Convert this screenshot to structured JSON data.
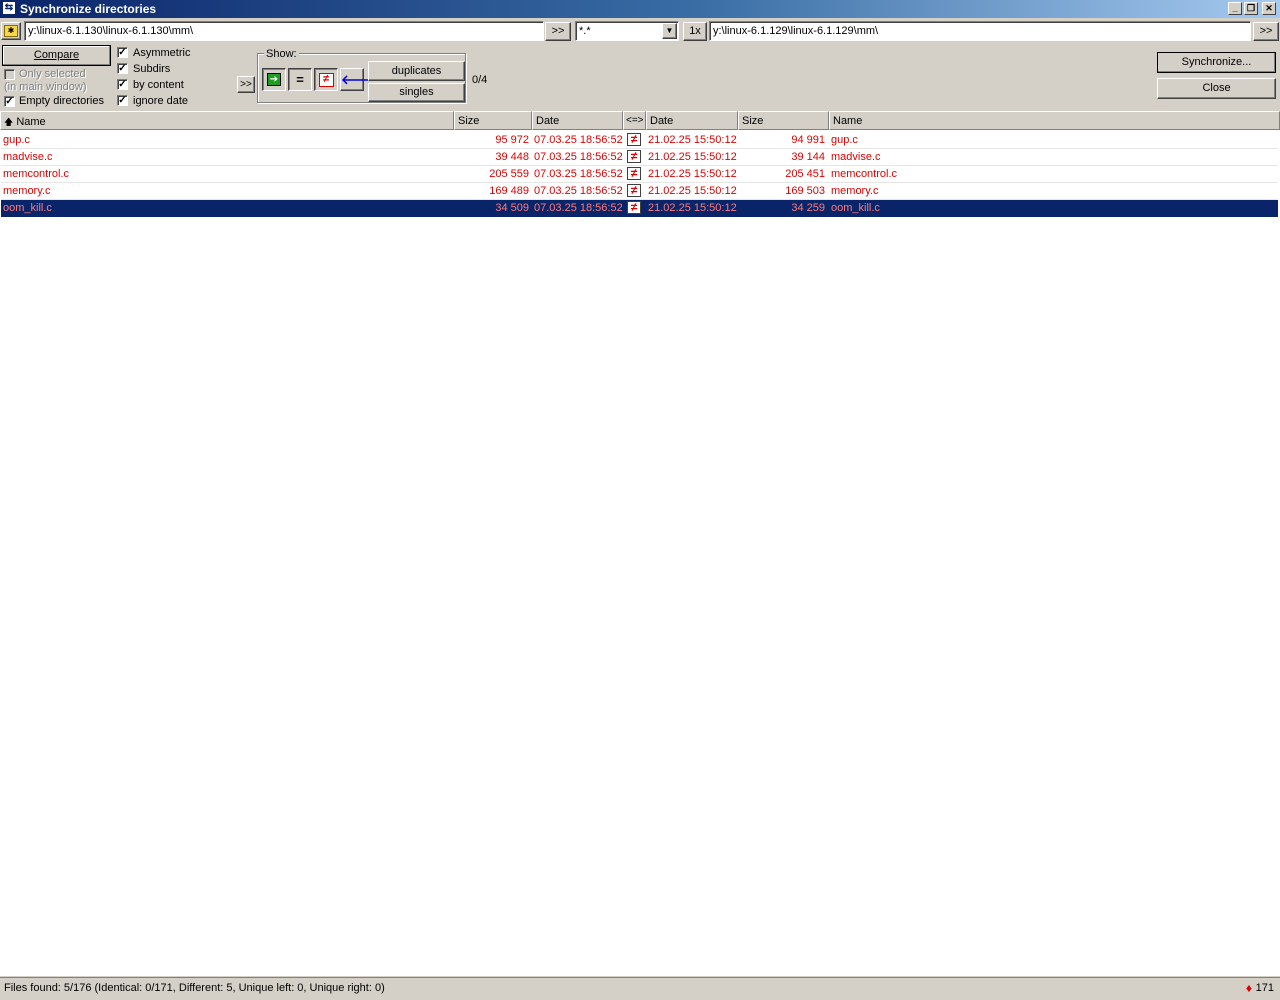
{
  "window": {
    "title": "Synchronize directories"
  },
  "toolbar": {
    "left_path": "y:\\linux-6.1.130\\linux-6.1.130\\mm\\",
    "browse_left_label": ">>",
    "filter_value": "*.*",
    "one_x_label": "1x",
    "right_path": "y:\\linux-6.1.129\\linux-6.1.129\\mm\\",
    "browse_right_label": ">>"
  },
  "options": {
    "compare_label": "Compare",
    "only_selected_label": "Only selected",
    "in_main_window_label": "(in main window)",
    "empty_dirs_label": "Empty directories",
    "asymmetric_label": "Asymmetric",
    "subdirs_label": "Subdirs",
    "by_content_label": "by content",
    "ignore_date_label": "ignore date",
    "expand_label": ">>",
    "show_label": "Show:",
    "duplicates_label": "duplicates",
    "singles_label": "singles",
    "count_label": "0/4",
    "synchronize_label": "Synchronize...",
    "close_label": "Close",
    "check_mark": "✓"
  },
  "columns": {
    "name_left": "Name",
    "size_left": "Size",
    "date_left": "Date",
    "compare": "<=>",
    "date_right": "Date",
    "size_right": "Size",
    "name_right": "Name",
    "sort_arrow": "🡅"
  },
  "rows": [
    {
      "name_left": "gup.c",
      "size_left": "95 972",
      "date_left": "07.03.25 18:56:52",
      "date_right": "21.02.25 15:50:12",
      "size_right": "94 991",
      "name_right": "gup.c"
    },
    {
      "name_left": "madvise.c",
      "size_left": "39 448",
      "date_left": "07.03.25 18:56:52",
      "date_right": "21.02.25 15:50:12",
      "size_right": "39 144",
      "name_right": "madvise.c"
    },
    {
      "name_left": "memcontrol.c",
      "size_left": "205 559",
      "date_left": "07.03.25 18:56:52",
      "date_right": "21.02.25 15:50:12",
      "size_right": "205 451",
      "name_right": "memcontrol.c"
    },
    {
      "name_left": "memory.c",
      "size_left": "169 489",
      "date_left": "07.03.25 18:56:52",
      "date_right": "21.02.25 15:50:12",
      "size_right": "169 503",
      "name_right": "memory.c"
    },
    {
      "name_left": "oom_kill.c",
      "size_left": "34 509",
      "date_left": "07.03.25 18:56:52",
      "date_right": "21.02.25 15:50:12",
      "size_right": "34 259",
      "name_right": "oom_kill.c"
    }
  ],
  "status": {
    "text": "Files found: 5/176  (Identical: 0/171, Different: 5, Unique left: 0, Unique right: 0)",
    "count": "171"
  },
  "colors": {
    "different": "#e00000",
    "selection": "#0a246a"
  }
}
